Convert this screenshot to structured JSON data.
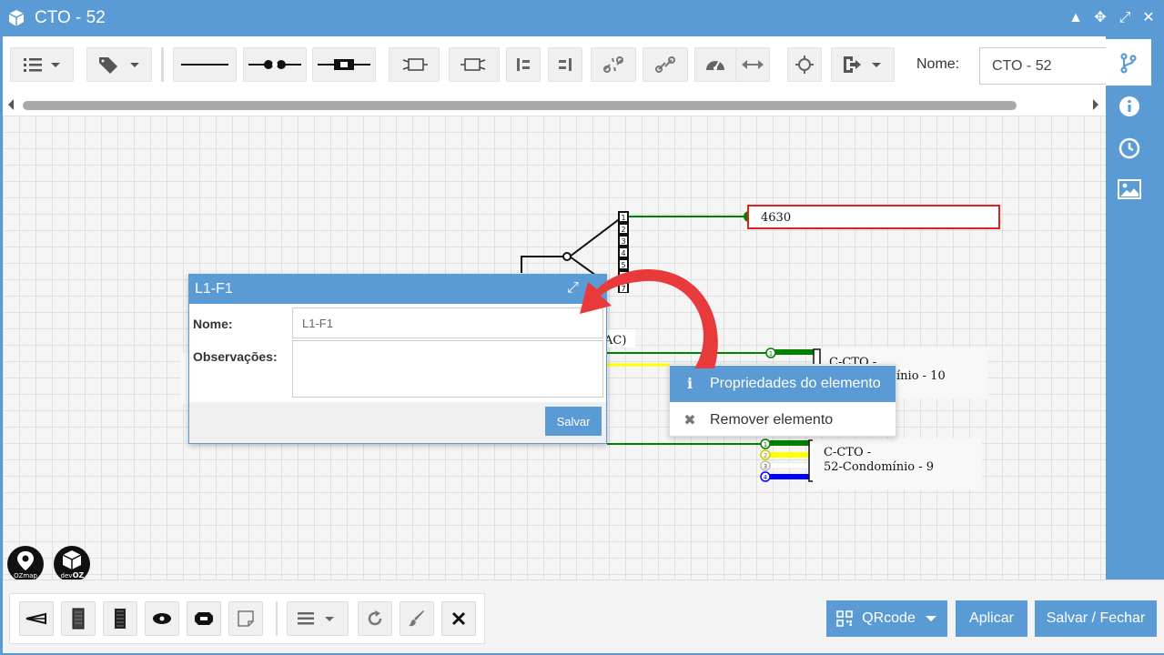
{
  "window": {
    "title": "CTO - 52"
  },
  "toolbar": {
    "nome_label": "Nome:",
    "nome_value": "CTO - 52"
  },
  "diagram": {
    "node_4630": "4630",
    "label_ac": "AC)",
    "label_cto10_line1": "C-CTO -",
    "label_cto10_line2": "ínio - 10",
    "label_cto9_line1": "C-CTO -",
    "label_cto9_line2": "52-Condomínio - 9",
    "port_numbers": [
      "1",
      "2",
      "3",
      "4",
      "5",
      "6",
      "7"
    ],
    "cable_ports_top": [
      "1"
    ],
    "cable_ports_bottom": [
      "1",
      "2",
      "3",
      "4"
    ]
  },
  "dialog": {
    "title": "L1-F1",
    "nome_label": "Nome:",
    "nome_value": "L1-F1",
    "obs_label": "Observações:",
    "obs_value": "",
    "save_label": "Salvar"
  },
  "context_menu": {
    "items": [
      {
        "label": "Propriedades do elemento",
        "icon": "info-icon"
      },
      {
        "label": "Remover elemento",
        "icon": "close-icon"
      }
    ]
  },
  "logos": {
    "ozmap": "OZmap",
    "devoz_a": "dev",
    "devoz_b": "OZ"
  },
  "bottom": {
    "qrcode_label": "QRcode",
    "apply_label": "Aplicar",
    "save_close_label": "Salvar / Fechar"
  },
  "colors": {
    "accent": "#5b9bd5",
    "fiber_green": "#008000",
    "fiber_yellow": "#ffff00",
    "fiber_blue": "#0000ff",
    "highlight_red": "#e02020"
  }
}
